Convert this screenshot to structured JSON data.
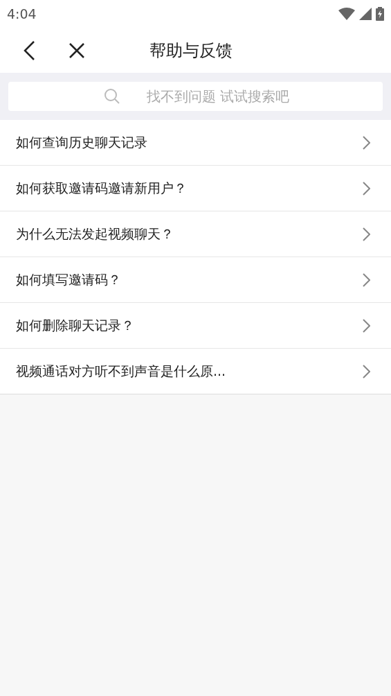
{
  "status_bar": {
    "time": "4:04"
  },
  "header": {
    "title": "帮助与反馈"
  },
  "search": {
    "placeholder": "找不到问题 试试搜索吧"
  },
  "questions": [
    {
      "text": "如何查询历史聊天记录"
    },
    {
      "text": "如何获取邀请码邀请新用户？"
    },
    {
      "text": "为什么无法发起视频聊天？"
    },
    {
      "text": "如何填写邀请码？"
    },
    {
      "text": "如何删除聊天记录？"
    },
    {
      "text": "视频通话对方听不到声音是什么原..."
    }
  ]
}
